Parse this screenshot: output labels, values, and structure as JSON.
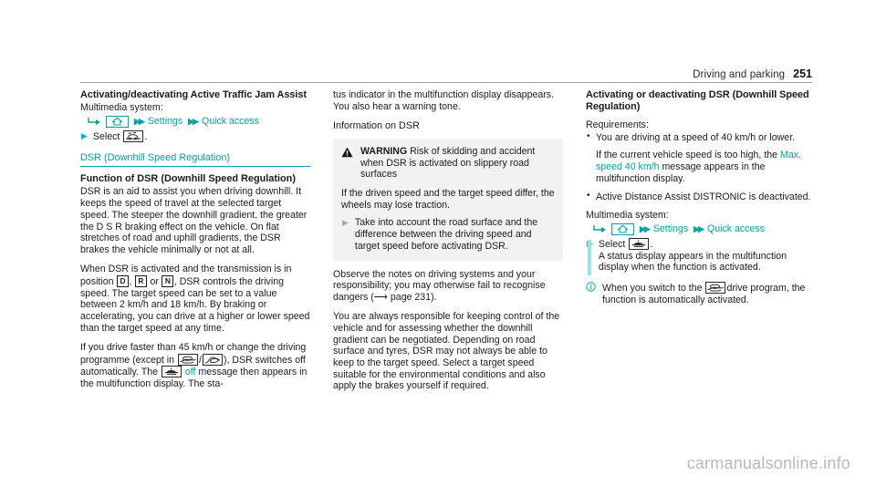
{
  "header": {
    "title": "Driving and parking",
    "page_number": "251"
  },
  "watermark": "carmanualsonline.info",
  "column1": {
    "heading": "Activating/deactivating Active Traffic Jam Assist",
    "multimedia_label": "Multimedia system:",
    "menu_path": [
      "Settings",
      "Quick access"
    ],
    "home_icon": "home-icon",
    "select_step": {
      "label": "Select",
      "icon": "traffic-jam-assist-icon",
      "trailing": "."
    },
    "link_heading": "DSR (Downhill Speed Regulation)",
    "function_heading": "Function of DSR (Downhill Speed Regulation)",
    "paragraph_1": "DSR is an aid to assist you when driving downhill. It keeps the speed of travel at the selected target speed. The steeper the downhill gradient, the greater the D S R braking effect on the vehicle. On flat stretches of road and uphill gradients, the DSR brakes the vehicle minimally or not at all.",
    "paragraph_2_a": "When DSR is activated and the transmission is in position",
    "gear_d": "D",
    "gear_r": "R",
    "gear_or": "or",
    "gear_n": "N",
    "paragraph_2_b": ", DSR controls the driving speed. The target speed can be set to a value between 2 km/h and 18 km/h. By braking or accelerating, you can drive at a higher or lower speed than the target speed at any time.",
    "paragraph_3_a": "If you drive faster than 45 km/h or change the driving programme (except in",
    "paragraph_3_slash": "/",
    "paragraph_3_b": "), DSR switches off automatically. The",
    "off_word": "off",
    "paragraph_3_c": "message then appears in the multifunction display. The sta-",
    "icon_offroad": "offroad-drive-program-icon",
    "icon_curve": "curve-drive-program-icon",
    "icon_dsr": "dsr-icon"
  },
  "column2": {
    "continuation": "tus indicator in the multifunction display disappears. You also hear a warning tone.",
    "info_heading": "Information on DSR",
    "warning": {
      "icon": "warning-triangle-icon",
      "label": "WARNING",
      "title": "Risk of skidding and accident when DSR is activated on slippery road surfaces",
      "body": "If the driven speed and the target speed differ, the wheels may lose traction.",
      "step": "Take into account the road surface and the difference between the driving speed and target speed before activating DSR."
    },
    "paragraph_1_a": "Observe the notes on driving systems and your responsibility; you may otherwise fail to recognise dangers (",
    "paragraph_1_ref": "page 231",
    "paragraph_1_b": ").",
    "paragraph_2": "You are always responsible for keeping control of the vehicle and for assessing whether the downhill gradient can be negotiated. Depending on road surface and tyres, DSR may not always be able to keep to the target speed. Select a target speed suitable for the environmental conditions and also apply the brakes yourself if required."
  },
  "column3": {
    "heading": "Activating or deactivating DSR (Downhill Speed Regulation)",
    "requirements_label": "Requirements:",
    "requirements": [
      "You are driving at a speed of 40 km/h or lower.",
      "Active Distance Assist DISTRONIC is deactivated."
    ],
    "requirement_note_a": "If the current vehicle speed is too high, the",
    "requirement_note_highlight": "Max. speed 40 km/h",
    "requirement_note_b": "message appears in the multifunction display.",
    "multimedia_label": "Multimedia system:",
    "menu_path": [
      "Settings",
      "Quick access"
    ],
    "home_icon": "home-icon",
    "select_step": {
      "label": "Select",
      "icon": "dsr-icon",
      "trailing": ".",
      "description": "A status display appears in the multifunction display when the function is activated."
    },
    "note": {
      "icon": "info-circle-icon",
      "text_a": "When you switch to the",
      "icon_inline": "offroad-drive-program-icon",
      "text_b": "drive program, the function is automatically activated."
    }
  },
  "colors": {
    "accent_teal": "#00a3a3",
    "step_triangle": "#00bcbc",
    "warning_bg": "#f2f2f2",
    "watermark": "#b9b9b9"
  }
}
